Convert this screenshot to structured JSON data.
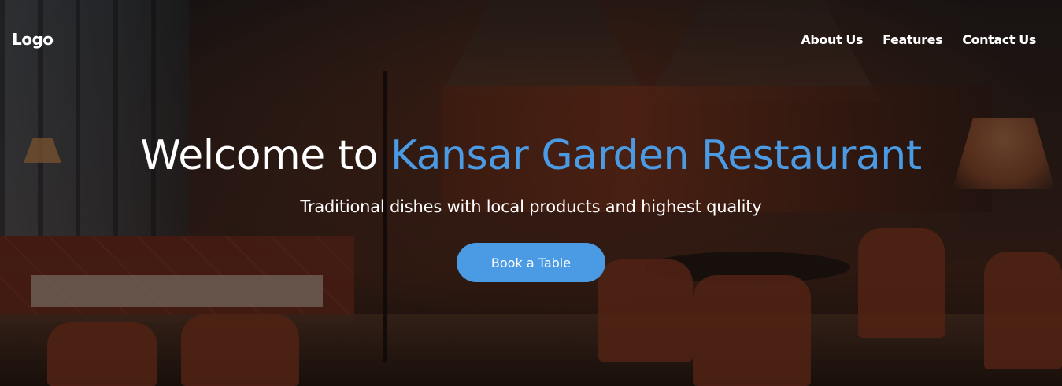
{
  "nav": {
    "logo": "Logo",
    "links": [
      "About Us",
      "Features",
      "Contact Us"
    ]
  },
  "hero": {
    "headline_prefix": "Welcome to ",
    "headline_accent": "Kansar Garden Restaurant",
    "subtitle": "Traditional dishes with local products and highest quality",
    "cta_label": "Book a Table"
  },
  "colors": {
    "accent": "#4a9be4",
    "text": "#ffffff",
    "overlay": "rgba(0,0,0,0.42)"
  },
  "background_image": "restaurant-interior"
}
